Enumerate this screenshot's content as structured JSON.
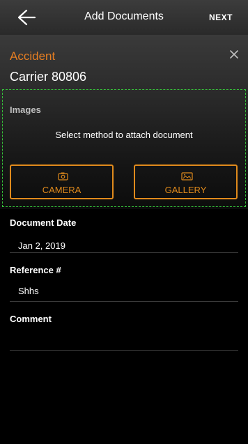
{
  "header": {
    "title": "Add Documents",
    "next_label": "NEXT"
  },
  "record": {
    "type": "Accident",
    "carrier": "Carrier 80806"
  },
  "images": {
    "label": "Images",
    "prompt": "Select method to attach document",
    "camera_label": "CAMERA",
    "gallery_label": "GALLERY"
  },
  "form": {
    "document_date": {
      "label": "Document Date",
      "value": "Jan 2, 2019"
    },
    "reference": {
      "label": "Reference #",
      "value": "Shhs"
    },
    "comment": {
      "label": "Comment",
      "value": ""
    }
  },
  "colors": {
    "accent": "#e67e22",
    "header_bg": "#333333",
    "dashed_outline": "#36c23a"
  }
}
